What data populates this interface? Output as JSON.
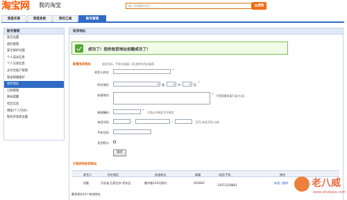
{
  "header": {
    "brand": "淘宝网",
    "subtitle": "我的淘宝",
    "search_placeholder": "输入您想要的宝贝",
    "search_button": "搜索"
  },
  "nav": {
    "tabs": [
      "我是买家",
      "我是卖家",
      "我的江湖",
      "账号管理"
    ],
    "active_index": 3
  },
  "sidebar": {
    "title": "账号管理",
    "items": [
      "安全设置",
      "密码管理",
      "安全保护问题",
      "个人成长信息",
      "个人交易信息",
      "支付宝账户管理",
      "登录邮箱维护",
      "收货地址",
      "订阅管理",
      "网站提醒",
      "社区信息",
      "博客(个人空间)",
      "旺旺开放者设置"
    ],
    "active_index": 7
  },
  "main": {
    "title": "收货地址",
    "success_message": "成功了！您的收货地址创建成功了！",
    "form": {
      "section_title": "新增收货地址",
      "section_hint": "电话号码、手机号选填一项,其余均为必填项",
      "labels": {
        "name": "收货人姓名:",
        "region": "所在地区:",
        "street": "街道地址:",
        "postcode": "邮政编码:",
        "phone": "电话号码:",
        "mobile": "手机号码:",
        "default": "设为默认:"
      },
      "province_suffix": "省",
      "city_suffix": "市",
      "district_suffix": "区",
      "street_hint": "不需要重复填写省/市/区",
      "postcode_hint": "大陆以外地区可不填写",
      "phone_hint": "区号-电话号码-分机",
      "save_button": "保存"
    },
    "saved": {
      "title": "已保存的收货地址",
      "columns": [
        "收货人",
        "所在地区",
        "街道地址",
        "邮编",
        "电话/手机",
        "操作"
      ],
      "rows": [
        {
          "name": "彭勤",
          "region": "河北省 石家庄市 桥东区",
          "street": "槐中路126号院内",
          "postcode": "050000",
          "phone": "13073128881",
          "actions": "修改 | 删除"
        }
      ],
      "footnote": "最多保存10个有效地址"
    }
  },
  "watermark": {
    "text": "老八威",
    "url": "www.shubajia.com"
  },
  "colors": {
    "brand_orange": "#ff5500",
    "nav_blue": "#2f6ac4",
    "success_green": "#4fa832"
  }
}
